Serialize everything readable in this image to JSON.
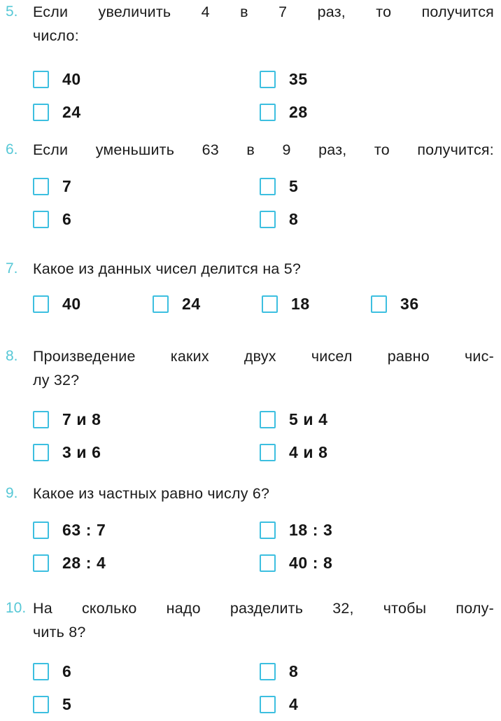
{
  "worksheet": {
    "accent_color": "#3dbfe0",
    "number_color": "#57c8d6",
    "text_color": "#1b1b1b",
    "background": "#ffffff"
  },
  "questions": [
    {
      "number": "5.",
      "lines": [
        {
          "justified": true,
          "words": [
            "Если",
            "увеличить",
            "4",
            "в",
            "7",
            "раз,",
            "то",
            "получится"
          ]
        },
        {
          "justified": false,
          "text": "число:"
        }
      ],
      "columns": 2,
      "options": [
        "40",
        "35",
        "24",
        "28"
      ]
    },
    {
      "number": "6.",
      "lines": [
        {
          "justified": true,
          "words": [
            "Если",
            "уменьшить",
            "63",
            "в",
            "9",
            "раз,",
            "то",
            "получится:"
          ]
        }
      ],
      "columns": 2,
      "options": [
        "7",
        "5",
        "6",
        "8"
      ]
    },
    {
      "number": "7.",
      "lines": [
        {
          "justified": false,
          "text": "Какое  из  данных  чисел  делится  на  5?"
        }
      ],
      "columns": 4,
      "options": [
        "40",
        "24",
        "18",
        "36"
      ]
    },
    {
      "number": "8.",
      "lines": [
        {
          "justified": true,
          "words": [
            "Произведение",
            "каких",
            "двух",
            "чисел",
            "равно",
            "чис-"
          ]
        },
        {
          "justified": false,
          "text": "лу  32?"
        }
      ],
      "columns": 2,
      "options": [
        "7 и 8",
        "5 и 4",
        "3 и 6",
        "4 и 8"
      ]
    },
    {
      "number": "9.",
      "lines": [
        {
          "justified": false,
          "text": "Какое  из  частных  равно  числу  6?"
        }
      ],
      "columns": 2,
      "options": [
        "63 : 7",
        "18 : 3",
        "28 : 4",
        "40 : 8"
      ]
    },
    {
      "number": "10.",
      "lines": [
        {
          "justified": true,
          "words": [
            "На",
            "сколько",
            "надо",
            "разделить",
            "32,",
            "чтобы",
            "полу-"
          ]
        },
        {
          "justified": false,
          "text": "чить  8?"
        }
      ],
      "columns": 2,
      "options": [
        "6",
        "8",
        "5",
        "4"
      ]
    }
  ]
}
